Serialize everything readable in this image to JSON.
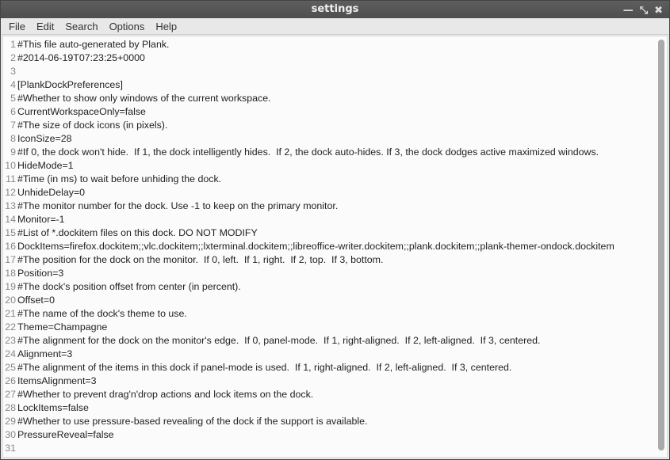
{
  "window": {
    "title": "settings"
  },
  "menu": [
    "File",
    "Edit",
    "Search",
    "Options",
    "Help"
  ],
  "lines": [
    "#This file auto-generated by Plank.",
    "#2014-06-19T07:23:25+0000",
    "",
    "[PlankDockPreferences]",
    "#Whether to show only windows of the current workspace.",
    "CurrentWorkspaceOnly=false",
    "#The size of dock icons (in pixels).",
    "IconSize=28",
    "#If 0, the dock won't hide.  If 1, the dock intelligently hides.  If 2, the dock auto-hides. If 3, the dock dodges active maximized windows.",
    "HideMode=1",
    "#Time (in ms) to wait before unhiding the dock.",
    "UnhideDelay=0",
    "#The monitor number for the dock. Use -1 to keep on the primary monitor.",
    "Monitor=-1",
    "#List of *.dockitem files on this dock. DO NOT MODIFY",
    "DockItems=firefox.dockitem;;vlc.dockitem;;lxterminal.dockitem;;libreoffice-writer.dockitem;;plank.dockitem;;plank-themer-ondock.dockitem",
    "#The position for the dock on the monitor.  If 0, left.  If 1, right.  If 2, top.  If 3, bottom.",
    "Position=3",
    "#The dock's position offset from center (in percent).",
    "Offset=0",
    "#The name of the dock's theme to use.",
    "Theme=Champagne",
    "#The alignment for the dock on the monitor's edge.  If 0, panel-mode.  If 1, right-aligned.  If 2, left-aligned.  If 3, centered.",
    "Alignment=3",
    "#The alignment of the items in this dock if panel-mode is used.  If 1, right-aligned.  If 2, left-aligned.  If 3, centered.",
    "ItemsAlignment=3",
    "#Whether to prevent drag'n'drop actions and lock items on the dock.",
    "LockItems=false",
    "#Whether to use pressure-based revealing of the dock if the support is available.",
    "PressureReveal=false",
    ""
  ]
}
